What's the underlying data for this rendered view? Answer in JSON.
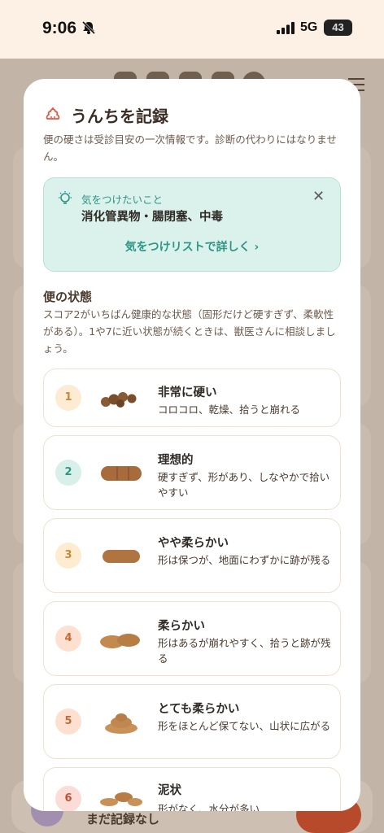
{
  "status_bar": {
    "time": "9:06",
    "network": "5G",
    "battery": "43"
  },
  "background": {
    "empty_label": "まだ記録なし"
  },
  "modal": {
    "title": "うんちを記録",
    "description": "便の硬さは受診目安の一次情報です。診断の代わりにはなりません。",
    "tip": {
      "label": "気をつけたいこと",
      "text": "消化管異物・腸閉塞、中毒",
      "link": "気をつけリストで詳しく ›",
      "close": "✕"
    },
    "section": {
      "title": "便の状態",
      "description": "スコア2がいちばん健康的な状態（固形だけど硬すぎず、柔軟性がある）。1や7に近い状態が続くときは、獣医さんに相談しましょう。"
    },
    "options": [
      {
        "num": "1",
        "name": "非常に硬い",
        "sub": "コロコロ、乾燥、拾うと崩れる",
        "badge_bg": "#fdebd4",
        "badge_color": "#c58a3a"
      },
      {
        "num": "2",
        "name": "理想的",
        "sub": "硬すぎず、形があり、しなやかで拾いやすい",
        "badge_bg": "#d9f0ea",
        "badge_color": "#2e9584"
      },
      {
        "num": "3",
        "name": "やや柔らかい",
        "sub": "形は保つが、地面にわずかに跡が残る",
        "badge_bg": "#fdecd0",
        "badge_color": "#c58a3a"
      },
      {
        "num": "4",
        "name": "柔らかい",
        "sub": "形はあるが崩れやすく、拾うと跡が残る",
        "badge_bg": "#fde0cf",
        "badge_color": "#c46a3a"
      },
      {
        "num": "5",
        "name": "とても柔らかい",
        "sub": "形をほとんど保てない、山状に広がる",
        "badge_bg": "#fde0cf",
        "badge_color": "#c46a3a"
      },
      {
        "num": "6",
        "name": "泥状",
        "sub": "形がなく、水分が多い",
        "badge_bg": "#fbdcd6",
        "badge_color": "#c4503a"
      }
    ]
  }
}
